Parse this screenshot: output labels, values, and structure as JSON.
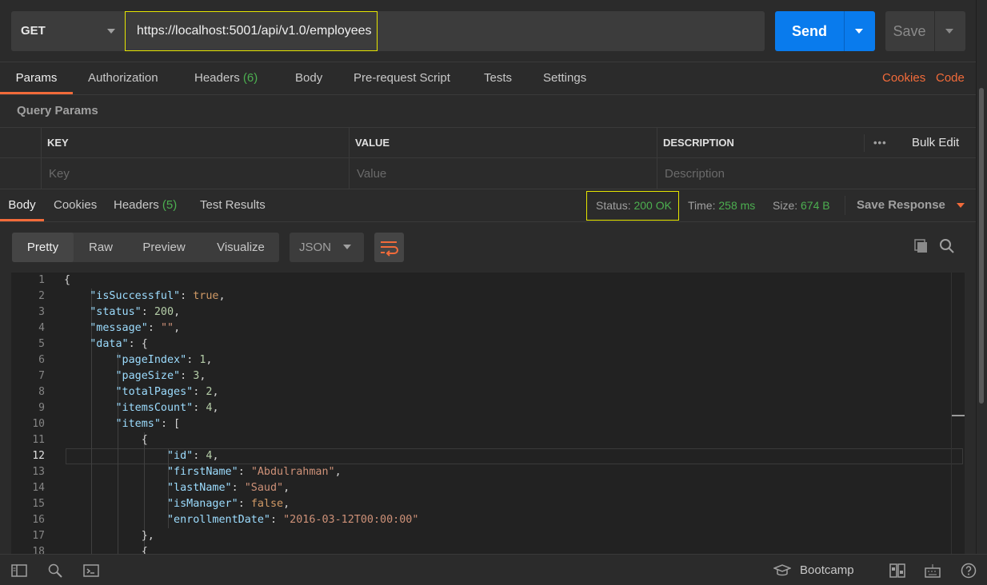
{
  "request": {
    "method": "GET",
    "url": "https://localhost:5001/api/v1.0/employees",
    "send_label": "Send",
    "save_label": "Save"
  },
  "request_tabs": [
    {
      "label": "Params",
      "count": ""
    },
    {
      "label": "Authorization",
      "count": ""
    },
    {
      "label": "Headers",
      "count": "(6)"
    },
    {
      "label": "Body",
      "count": ""
    },
    {
      "label": "Pre-request Script",
      "count": ""
    },
    {
      "label": "Tests",
      "count": ""
    },
    {
      "label": "Settings",
      "count": ""
    }
  ],
  "request_links": {
    "cookies": "Cookies",
    "code": "Code"
  },
  "query_params": {
    "title": "Query Params",
    "headers": {
      "key": "KEY",
      "value": "VALUE",
      "description": "DESCRIPTION"
    },
    "more": "•••",
    "bulk_edit": "Bulk Edit",
    "placeholders": {
      "key": "Key",
      "value": "Value",
      "description": "Description"
    }
  },
  "response_tabs": [
    {
      "label": "Body",
      "count": ""
    },
    {
      "label": "Cookies",
      "count": ""
    },
    {
      "label": "Headers",
      "count": "(5)"
    },
    {
      "label": "Test Results",
      "count": ""
    }
  ],
  "response_meta": {
    "status_label": "Status:",
    "status_value": "200 OK",
    "time_label": "Time:",
    "time_value": "258 ms",
    "size_label": "Size:",
    "size_value": "674 B",
    "save_response": "Save Response"
  },
  "body_views": [
    "Pretty",
    "Raw",
    "Preview",
    "Visualize"
  ],
  "body_format": "JSON",
  "code": {
    "current_line": 12,
    "line_numbers": [
      "1",
      "2",
      "3",
      "4",
      "5",
      "6",
      "7",
      "8",
      "9",
      "10",
      "11",
      "12",
      "13",
      "14",
      "15",
      "16",
      "17",
      "18"
    ]
  },
  "footer": {
    "bootcamp": "Bootcamp"
  },
  "colors": {
    "accent": "#f26b3a",
    "send": "#097bed",
    "ok": "#4caf50",
    "highlight": "#e6e600"
  }
}
